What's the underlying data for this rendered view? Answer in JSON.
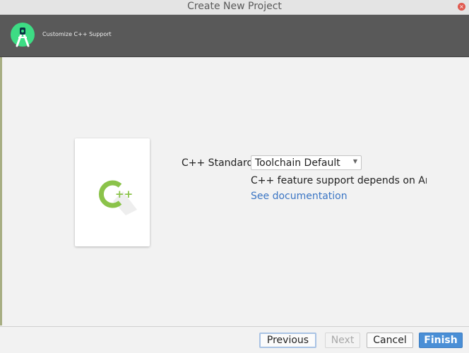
{
  "window": {
    "title": "Create New Project",
    "close_glyph": "×"
  },
  "banner": {
    "title": "Customize C++ Support",
    "icon": "android-studio-logo-icon"
  },
  "card": {
    "icon": "cpp-icon",
    "icon_label": "++"
  },
  "form": {
    "cpp_standard_label": "C++ Standard",
    "cpp_standard_value": "Toolchain Default",
    "feature_note": "C++ feature support depends on Android NDK and CMake versions.",
    "doc_link": "See documentation"
  },
  "buttons": {
    "previous": "Previous",
    "next": "Next",
    "cancel": "Cancel",
    "finish": "Finish"
  },
  "colors": {
    "banner": "#595959",
    "accent": "#4a8fd6",
    "link": "#3a75c4",
    "cpp_green": "#8bc34a"
  }
}
